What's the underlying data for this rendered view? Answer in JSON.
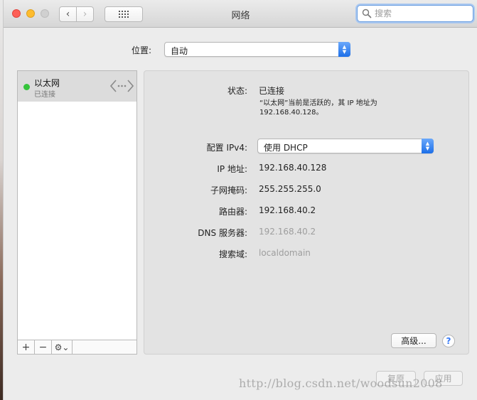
{
  "window": {
    "title": "网络"
  },
  "search": {
    "placeholder": "搜索",
    "value": ""
  },
  "location": {
    "label": "位置:",
    "value": "自动"
  },
  "services": [
    {
      "name": "以太网",
      "status": "已连接",
      "status_color": "#35c43b",
      "icon": "ethernet-arrows-icon"
    }
  ],
  "sidebar_toolbar": {
    "add": "+",
    "remove": "−",
    "gear": "⚙︎⌄"
  },
  "detail": {
    "status_label": "状态:",
    "status_value": "已连接",
    "status_desc_line1": "“以太网”当前是活跃的，其 IP 地址为",
    "status_desc_line2": "192.168.40.128。",
    "config_label": "配置 IPv4:",
    "config_value": "使用 DHCP",
    "ip_label": "IP 地址:",
    "ip_value": "192.168.40.128",
    "subnet_label": "子网掩码:",
    "subnet_value": "255.255.255.0",
    "router_label": "路由器:",
    "router_value": "192.168.40.2",
    "dns_label": "DNS 服务器:",
    "dns_value": "192.168.40.2",
    "search_domain_label": "搜索域:",
    "search_domain_value": "localdomain"
  },
  "buttons": {
    "advanced": "高级...",
    "help": "?",
    "revert": "复原",
    "apply": "应用"
  },
  "watermark": "http://blog.csdn.net/woodsun2008",
  "colors": {
    "accent": "#1d6fe8",
    "connected": "#35c43b"
  }
}
